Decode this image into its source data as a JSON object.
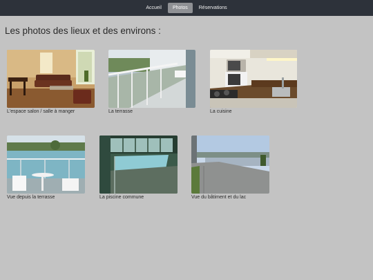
{
  "nav": {
    "items": [
      {
        "label": "Accueil",
        "active": false
      },
      {
        "label": "Photos",
        "active": true
      },
      {
        "label": "Réservations",
        "active": false
      }
    ]
  },
  "page": {
    "title": "Les photos des lieux et des environs :"
  },
  "photos": [
    {
      "caption": "L'espace salon / salle à manger",
      "subject": "living-dining-room"
    },
    {
      "caption": "La terrasse",
      "subject": "terrace"
    },
    {
      "caption": "La cuisine",
      "subject": "kitchen"
    },
    {
      "caption": "Vue depuis la terrasse",
      "subject": "view-from-terrace"
    },
    {
      "caption": "La piscine commune",
      "subject": "shared-pool"
    },
    {
      "caption": "Vue du bâtiment et du lac",
      "subject": "building-and-lake"
    }
  ],
  "colors": {
    "navbar_bg": "#2d323a",
    "nav_active_bg": "#8f9195",
    "page_bg": "#c3c3c3"
  }
}
